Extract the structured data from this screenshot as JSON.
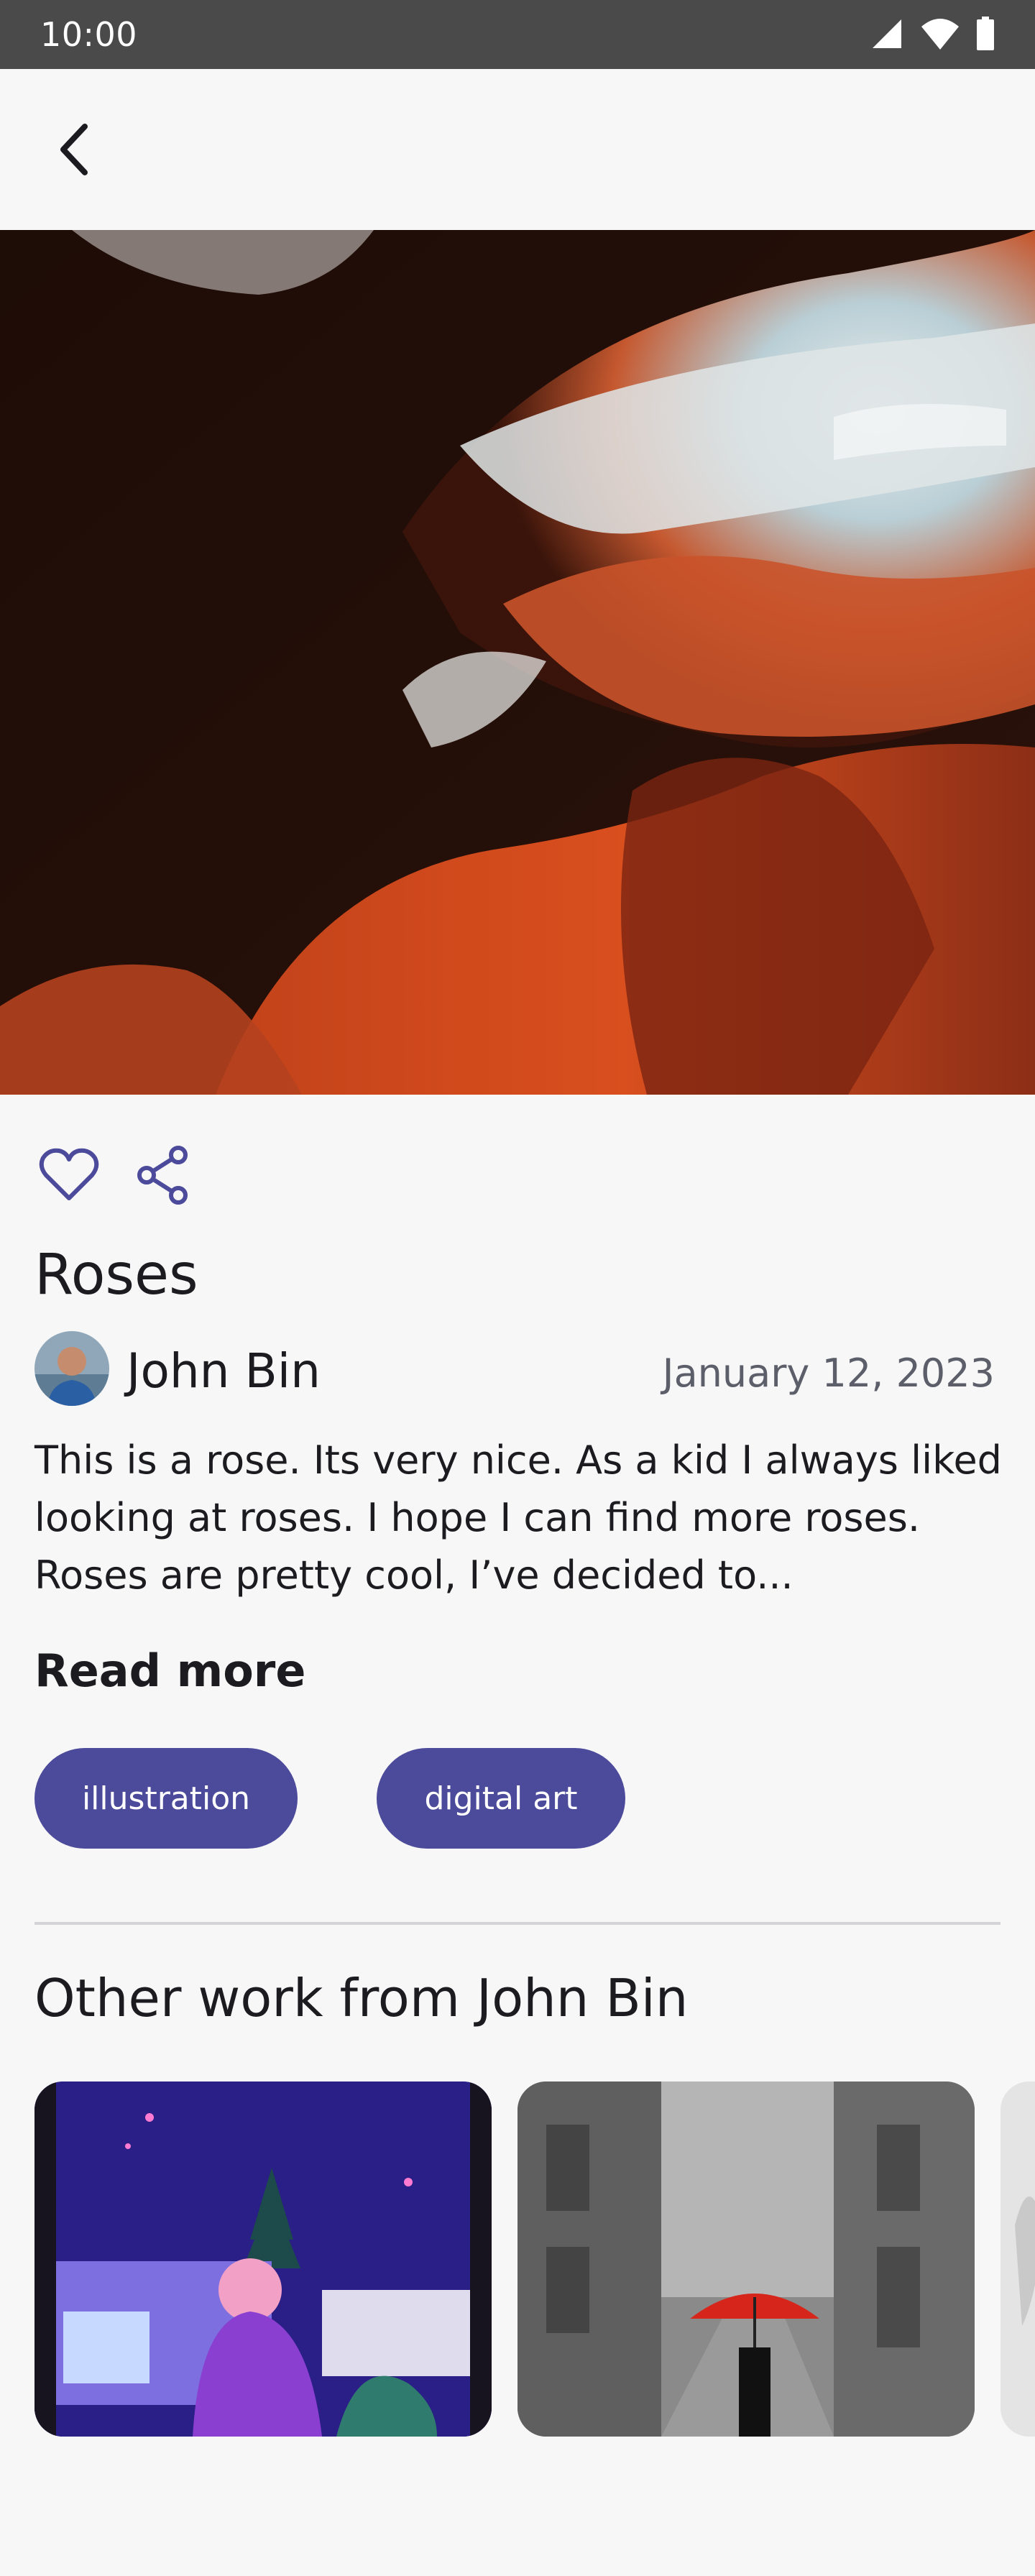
{
  "status_bar": {
    "time": "10:00",
    "icons": [
      "signal-icon",
      "wifi-icon",
      "battery-icon"
    ]
  },
  "app_bar": {
    "back_icon": "chevron-left-icon"
  },
  "artwork": {
    "title": "Roses",
    "author": "John Bin",
    "date": "January 12, 2023",
    "description": "This is a rose. Its very nice. As a kid I always liked looking at roses. I hope I can find more roses. Roses are pretty cool, I’ve decided to...",
    "read_more_label": "Read more",
    "tags": [
      "illustration",
      "digital art"
    ]
  },
  "actions": {
    "like_icon": "heart-outline-icon",
    "share_icon": "share-icon"
  },
  "other_work": {
    "title": "Other work from John Bin",
    "items": [
      {
        "icon": "artwork-thumbnail"
      },
      {
        "icon": "artwork-thumbnail"
      },
      {
        "icon": "artwork-thumbnail"
      }
    ]
  },
  "colors": {
    "accent": "#4c4a9a",
    "background": "#f7f7f8",
    "status_bar": "#4a4a4a",
    "secondary_text": "#5c5f6a"
  }
}
